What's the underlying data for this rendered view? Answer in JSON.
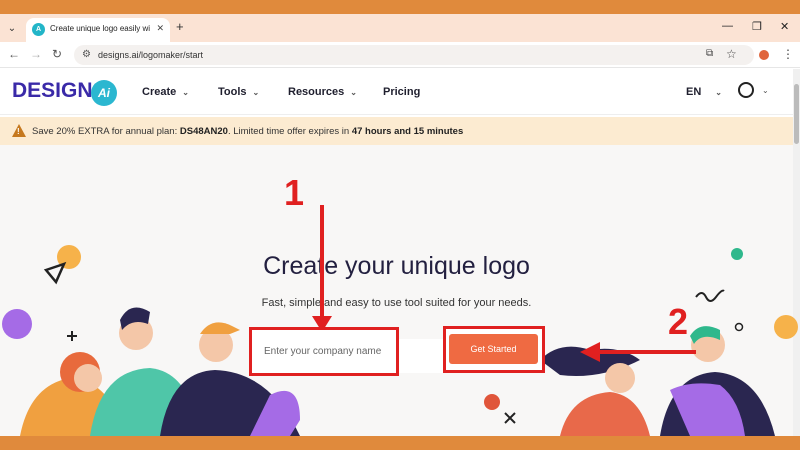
{
  "browser": {
    "tab_title": "Create unique logo easily with D",
    "url": "designs.ai/logomaker/start"
  },
  "site": {
    "logo_text": "DESIGNS.",
    "logo_ai": "Ai",
    "nav": [
      {
        "label": "Create"
      },
      {
        "label": "Tools"
      },
      {
        "label": "Resources"
      },
      {
        "label": "Pricing"
      }
    ],
    "language": "EN"
  },
  "promo": {
    "prefix": "Save 20% EXTRA for annual plan: ",
    "code": "DS48AN20",
    "middle": ". Limited time offer expires in ",
    "time": "47 hours and 15 minutes"
  },
  "hero": {
    "title": "Create your unique logo",
    "subtitle": "Fast, simple and easy to use tool suited for your needs.",
    "input_placeholder": "Enter your company name",
    "cta_label": "Get Started"
  },
  "annotations": {
    "step1": "1",
    "step2": "2"
  },
  "colors": {
    "brand": "#3a2aa8",
    "accent": "#ef6a42",
    "annotation": "#e02020",
    "border": "#e08a3c"
  }
}
